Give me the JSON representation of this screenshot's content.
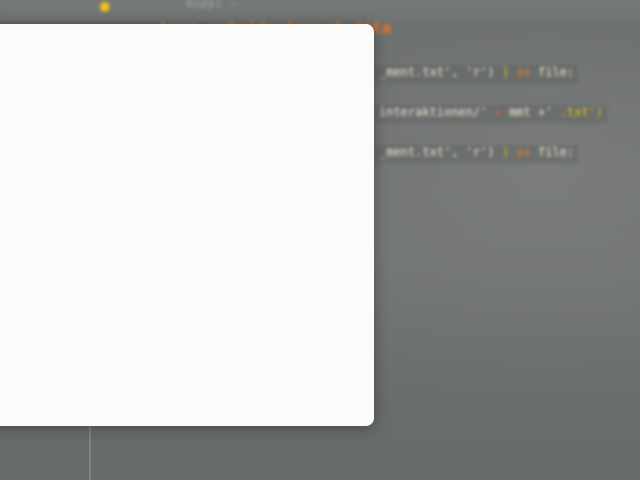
{
  "editor": {
    "top_glyph": "●",
    "top_faint_text": "mipy) -",
    "comment": "Loop outside import data",
    "lines": [
      {
        "a": "_ment.txt', 'r')",
        "paren": ")",
        "kw": "as",
        "b": "file:"
      },
      {
        "a": "interaktionen/'",
        "op": "+",
        "b": "mmt +'",
        "c": ".txt')"
      },
      {
        "a": "_ment.txt', 'r')",
        "paren": ")",
        "kw": "as",
        "b": "file:"
      }
    ]
  },
  "dialog": {
    "content": ""
  }
}
